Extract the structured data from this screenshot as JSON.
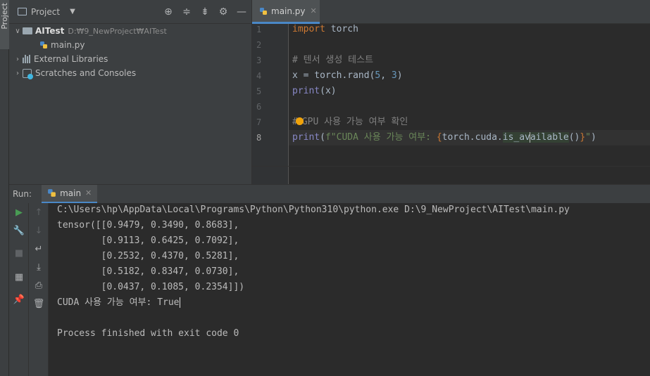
{
  "sidebar": {
    "vertical_tab_label": "Project"
  },
  "project_panel": {
    "title": "Project",
    "header_icons": [
      "locate-icon",
      "expand-all-icon",
      "collapse-all-icon",
      "gear-icon",
      "minimize-icon"
    ],
    "tree": [
      {
        "name": "AITest",
        "path": "D:₩9_NewProject₩AITest",
        "expanded": true,
        "icon": "folder-icon"
      },
      {
        "name": "main.py",
        "icon": "python-file-icon"
      },
      {
        "name": "External Libraries",
        "icon": "library-icon"
      },
      {
        "name": "Scratches and Consoles",
        "icon": "scratches-icon"
      }
    ]
  },
  "editor": {
    "tab": {
      "label": "main.py",
      "icon": "python-file-icon"
    },
    "line_numbers": [
      "1",
      "2",
      "3",
      "4",
      "5",
      "6",
      "7",
      "8"
    ],
    "code": {
      "l1_kw": "import",
      "l1_rest": " torch",
      "l3": "# 텐서 생성 테스트",
      "l4_a": "x = torch.rand(",
      "l4_n1": "5",
      "l4_sep": ", ",
      "l4_n2": "3",
      "l4_end": ")",
      "l5_fn": "print",
      "l5_rest": "(x)",
      "l7_a": "#",
      "l7_b": "GPU 사용 가능 여부 확인",
      "l8_fn": "print",
      "l8_open": "(",
      "l8_str": "f\"CUDA 사용 가능 여부: ",
      "l8_brace_open": "{",
      "l8_expr1": "torch.cuda.",
      "l8_expr2": "is_av",
      "l8_expr3": "ailable",
      "l8_expr4": "()",
      "l8_brace_close": "}",
      "l8_str_end": "\"",
      "l8_close": ")"
    }
  },
  "run_window": {
    "label": "Run:",
    "tab_label": "main",
    "tab_icon": "python-icon",
    "toolbar_left": [
      "run-icon",
      "wrench-icon",
      "stop-icon",
      "layout-icon",
      "pin-icon"
    ],
    "toolbar_right": [
      "up-arrow-icon",
      "down-arrow-icon",
      "soft-wrap-icon",
      "scroll-to-end-icon",
      "print-icon",
      "trash-icon"
    ],
    "console": [
      "C:\\Users\\hp\\AppData\\Local\\Programs\\Python\\Python310\\python.exe D:\\9_NewProject\\AITest\\main.py",
      "tensor([[0.9479, 0.3490, 0.8683],",
      "        [0.9113, 0.6425, 0.7092],",
      "        [0.2532, 0.4370, 0.5281],",
      "        [0.5182, 0.8347, 0.0730],",
      "        [0.0437, 0.1085, 0.2354]])",
      "CUDA 사용 가능 여부: True",
      "",
      "Process finished with exit code 0"
    ]
  },
  "colors": {
    "keyword": "#cc7832",
    "number": "#6897bb",
    "comment": "#808080",
    "string": "#6a8759",
    "builtin": "#8888c6",
    "accent": "#4a88c7",
    "run_green": "#499c54"
  }
}
